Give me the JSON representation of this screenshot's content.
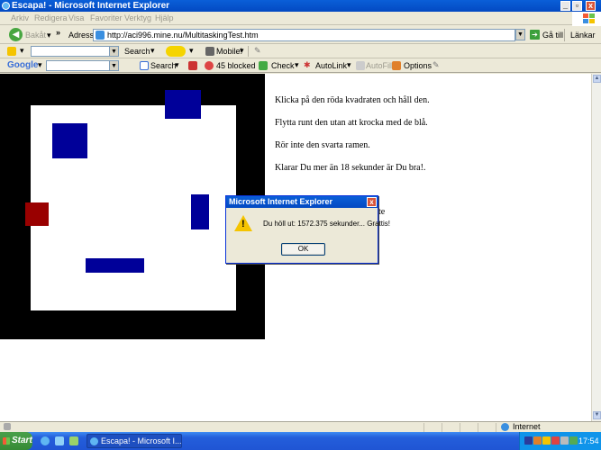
{
  "window": {
    "title": "Escapa! - Microsoft Internet Explorer",
    "controls": [
      "_",
      "▫",
      "x"
    ]
  },
  "menu": [
    "Arkiv",
    "Redigera",
    "Visa",
    "Favoriter",
    "Verktyg",
    "Hjälp"
  ],
  "nav": {
    "back_label": "Bakåt",
    "chevron": "»",
    "address_label": "Adress",
    "url": "http://aci996.mine.nu/MultitaskingTest.htm",
    "go_label": "Gå till",
    "links_label": "Länkar"
  },
  "toolbar1": {
    "search_label": "Search",
    "mobile_label": "Mobile!"
  },
  "toolbar2": {
    "google_label": "Google",
    "search_label": "Search",
    "blocked_label": "45 blocked",
    "check_label": "Check",
    "autolink_label": "AutoLink",
    "autofill_label": "AutoFill",
    "options_label": "Options"
  },
  "page": {
    "instructions": [
      "Klicka på den röda kvadraten och håll den.",
      "Flytta runt den utan att krocka med de blå.",
      "Rör inte den svarta ramen.",
      "Klarar Du mer än 18 sekunder är Du bra!."
    ],
    "partial_text": "te"
  },
  "dialog": {
    "title": "Microsoft Internet Explorer",
    "message": "Du höll ut: 1572.375 sekunder... Grattis!",
    "ok_label": "OK",
    "close_glyph": "x"
  },
  "status": {
    "zone_label": "Internet"
  },
  "taskbar": {
    "start_label": "Start",
    "task_label": "Escapa! - Microsoft I...",
    "clock": "17:54"
  },
  "colors": {
    "game_frame": "#000000",
    "blue_blocks": "#000099",
    "red_block": "#990000",
    "title_bar": "#0a5fd8"
  }
}
